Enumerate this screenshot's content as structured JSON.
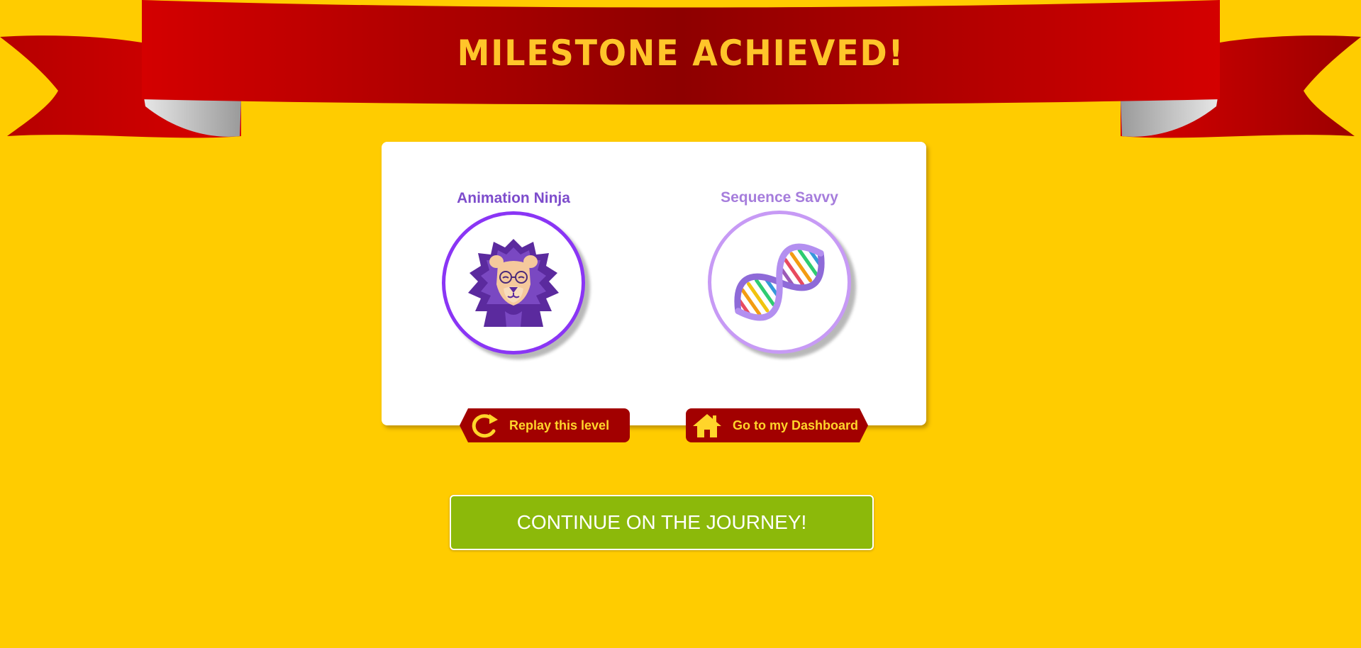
{
  "banner": {
    "title": "MILESTONE ACHIEVED!"
  },
  "badges": [
    {
      "label": "Animation Ninja",
      "icon": "lion-icon",
      "ring_color": "#8a35f5"
    },
    {
      "label": "Sequence Savvy",
      "icon": "dna-icon",
      "ring_color": "#c79af5"
    }
  ],
  "actions": {
    "replay_label": "Replay this level",
    "replay_icon": "replay-icon",
    "dashboard_label": "Go to my Dashboard",
    "dashboard_icon": "home-icon"
  },
  "continue_label": "CONTINUE ON THE JOURNEY!",
  "colors": {
    "background": "#ffcc00",
    "ribbon": "#c00000",
    "tag_button": "#a20000",
    "tag_text": "#ffd52a",
    "continue_button": "#8cb90a"
  }
}
